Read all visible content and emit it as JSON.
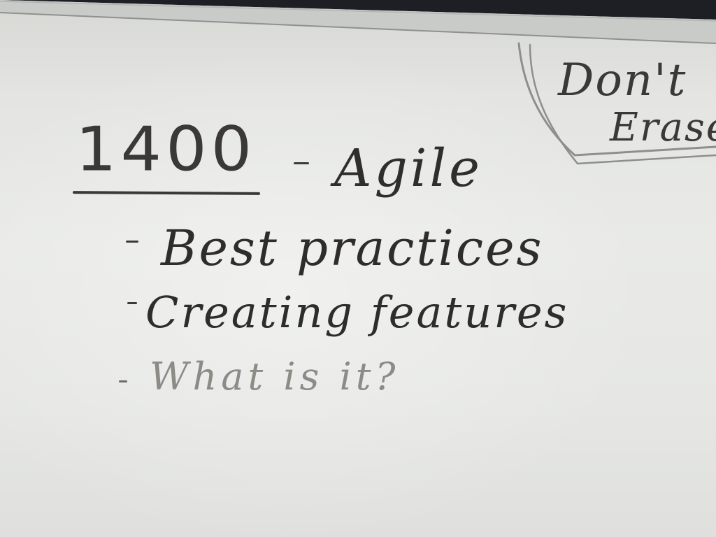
{
  "whiteboard": {
    "heading_number": "1400",
    "heading_topic": "Agile",
    "bullets": [
      "Best practices",
      "Creating features",
      "What is it?"
    ],
    "corner_note_line1": "Don't",
    "corner_note_line2": "Erase"
  },
  "colors": {
    "board": "#e6e7e4",
    "ink": "#2e2d2a",
    "faded_ink": "#8c8b86",
    "frame": "#9a9c9c"
  }
}
